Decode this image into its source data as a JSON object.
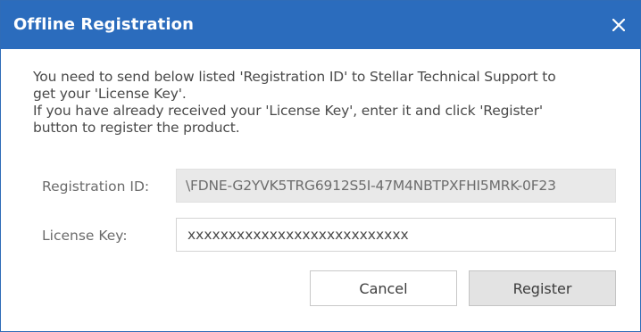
{
  "window": {
    "title": "Offline Registration",
    "titlebar_color": "#2b6cbd"
  },
  "message": {
    "line1": "You need to send below listed 'Registration ID' to Stellar Technical Support to",
    "line2": "get your 'License Key'.",
    "line3": "If you have already received your 'License Key', enter it and click 'Register'",
    "line4": "button to register the product."
  },
  "registration": {
    "label": "Registration ID:",
    "value": "\\FDNE-G2YVK5TRG6912S5I-47M4NBTPXFHI5MRK-0F23"
  },
  "license": {
    "label": "License Key:",
    "value": "xxxxxxxxxxxxxxxxxxxxxxxxxxx"
  },
  "buttons": {
    "cancel": "Cancel",
    "register": "Register"
  },
  "icons": {
    "close": "close-icon"
  }
}
